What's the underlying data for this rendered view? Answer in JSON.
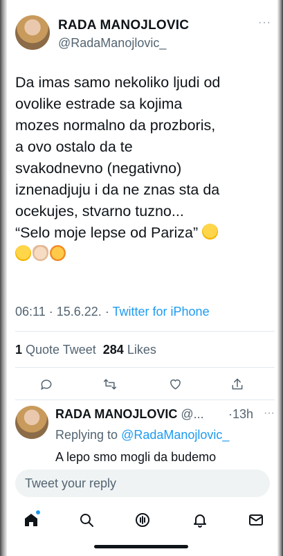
{
  "tweet": {
    "author_name": "RADA MANOJLOVIC",
    "author_handle": "@RadaManojlovic_",
    "more_label": "···",
    "text": "Da imas samo nekoliko ljudi od\novolike estrade sa kojima\nmozes normalno da prozboris,\na ovo ostalo da te\nsvakodnevno (negativno)\niznenadjuju i da ne znas sta da\nocekujes, stvarno tuzno...\n“Selo moje lepse od Pariza” ",
    "emojis": [
      "rolling-on-floor-laughing",
      "grinning-face",
      "ok-hand",
      "partying-face"
    ],
    "time": "06:11",
    "date": "15.6.22.",
    "separator": "·",
    "source": "Twitter for iPhone",
    "quote_count": "1",
    "quote_label": "Quote Tweet",
    "like_count": "284",
    "like_label": "Likes"
  },
  "actions": [
    {
      "name": "reply",
      "icon": "reply-icon"
    },
    {
      "name": "retweet",
      "icon": "retweet-icon"
    },
    {
      "name": "like",
      "icon": "heart-icon"
    },
    {
      "name": "share",
      "icon": "share-icon"
    }
  ],
  "reply": {
    "author_name": "RADA MANOJLOVIC",
    "author_handle": "@...",
    "time": "·13h",
    "more_label": "···",
    "replying_prefix": "Replying to",
    "replying_mention": "@RadaManojlovic_",
    "text": "A lepo smo mogli da budemo"
  },
  "composer": {
    "placeholder": "Tweet your reply"
  },
  "tabbar": [
    {
      "name": "home",
      "icon": "home-icon",
      "active": true
    },
    {
      "name": "search",
      "icon": "search-icon"
    },
    {
      "name": "spaces",
      "icon": "spaces-icon"
    },
    {
      "name": "notifications",
      "icon": "bell-icon"
    },
    {
      "name": "messages",
      "icon": "mail-icon"
    }
  ],
  "colors": {
    "accent": "#1d9bf0",
    "text": "#0f1419",
    "secondary": "#536471",
    "input_bg": "#eff3f4"
  }
}
